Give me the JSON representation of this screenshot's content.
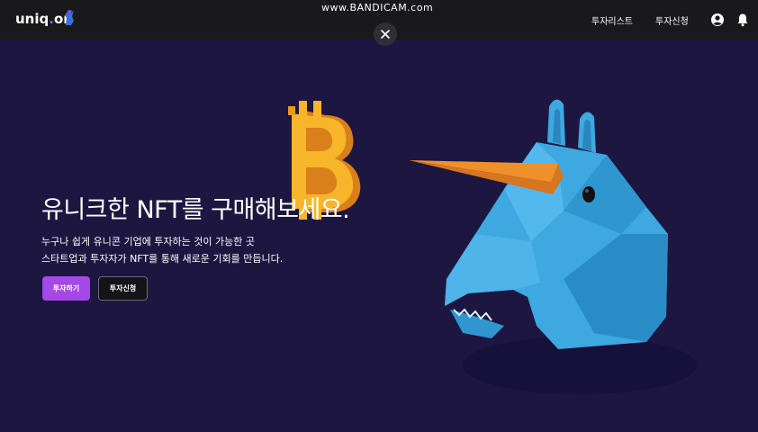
{
  "header": {
    "logo": {
      "text_main": "uniq",
      "text_dot": ".",
      "text_tail": "on"
    },
    "watermark": "www.BANDICAM.com",
    "nav": [
      {
        "label": "투자리스트"
      },
      {
        "label": "투자신청"
      }
    ],
    "icons": [
      "account-circle-icon",
      "bell-icon"
    ]
  },
  "overlay": {
    "close_icon": "close-icon"
  },
  "hero": {
    "title": "유니크한 NFT를 구매해보세요.",
    "description_line1": "누구나 쉽게 유니콘 기업에 투자하는 것이 가능한 곳",
    "description_line2": "스타트업과 투자자가 NFT를 통해 새로운 기회를 만듭니다.",
    "primary_button": "투자하기",
    "secondary_button": "투자신청"
  },
  "colors": {
    "background": "#1c1640",
    "topbar": "#19191c",
    "accent": "#a448e8",
    "bitcoin": "#f5a623",
    "unicorn": "#3ea8e0",
    "horn": "#f0902a"
  }
}
